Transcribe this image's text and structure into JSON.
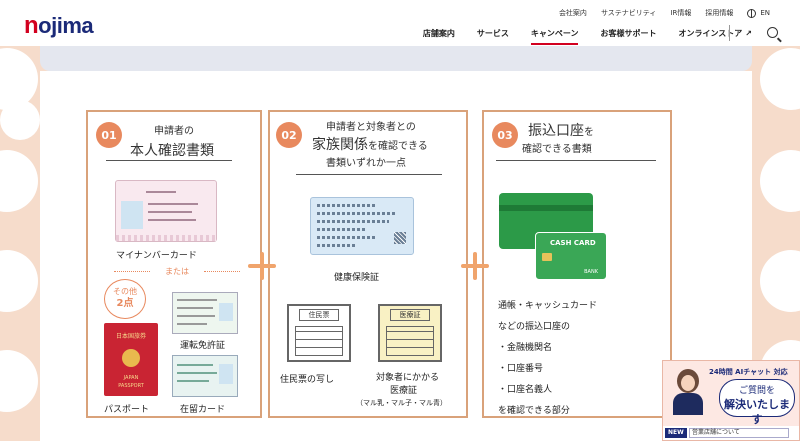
{
  "header": {
    "logo_text": "nojima",
    "utility_links": [
      "会社案内",
      "サステナビリティ",
      "IR情報",
      "採用情報"
    ],
    "language": "EN",
    "nav": [
      "店舗案内",
      "サービス",
      "キャンペーン",
      "お客様サポート",
      "オンラインストア"
    ],
    "active_nav": "キャンペーン",
    "ext_icon": "↗"
  },
  "section1": {
    "number": "01",
    "title_small": "申請者の",
    "title_big": "本人確認書類",
    "card_label": "マイナンバーカード",
    "or_text": "または",
    "other_pill": [
      "その他",
      "2点"
    ],
    "license_label": "運転免許証",
    "passport_label": "パスポート",
    "residence_label": "在留カード",
    "passport_jp": "日本国旅券",
    "passport_en1": "JAPAN",
    "passport_en2": "PASSPORT"
  },
  "section2": {
    "number": "02",
    "title_small": "申請者と対象者との",
    "title_big": "家族関係",
    "title_rest": "を確認できる",
    "title_line3": "書類いずれか一点",
    "insurance_label": "健康保険証",
    "juminhyo_doc": "住民票",
    "iryosho_doc": "医療証",
    "juminhyo_label": "住民票の写し",
    "iryosho_label1": "対象者にかかる",
    "iryosho_label2": "医療証",
    "iryosho_note": "（マル乳・マル子・マル青）"
  },
  "section3": {
    "number": "03",
    "title_big": "振込口座",
    "title_rest": "を",
    "title_line2": "確認できる書類",
    "card_text": "CASH CARD",
    "bank_text": "BANK",
    "list": [
      "通帳・キャッシュカード",
      "などの振込口座の",
      "・金融機関名",
      "・口座番号",
      "・口座名義人",
      "を確認できる部分"
    ]
  },
  "chat": {
    "ai_label": "24時間 AIチャット 対応",
    "bubble_line1": "ご質問を",
    "bubble_line2": "解決いたします",
    "new_badge": "NEW",
    "input_text": "営業店舗について"
  },
  "colors": {
    "accent": "#e8895e",
    "brand_navy": "#1b2a78",
    "brand_red": "#d2001f",
    "box_border": "#d9a27a",
    "background": "#f6dccb"
  }
}
